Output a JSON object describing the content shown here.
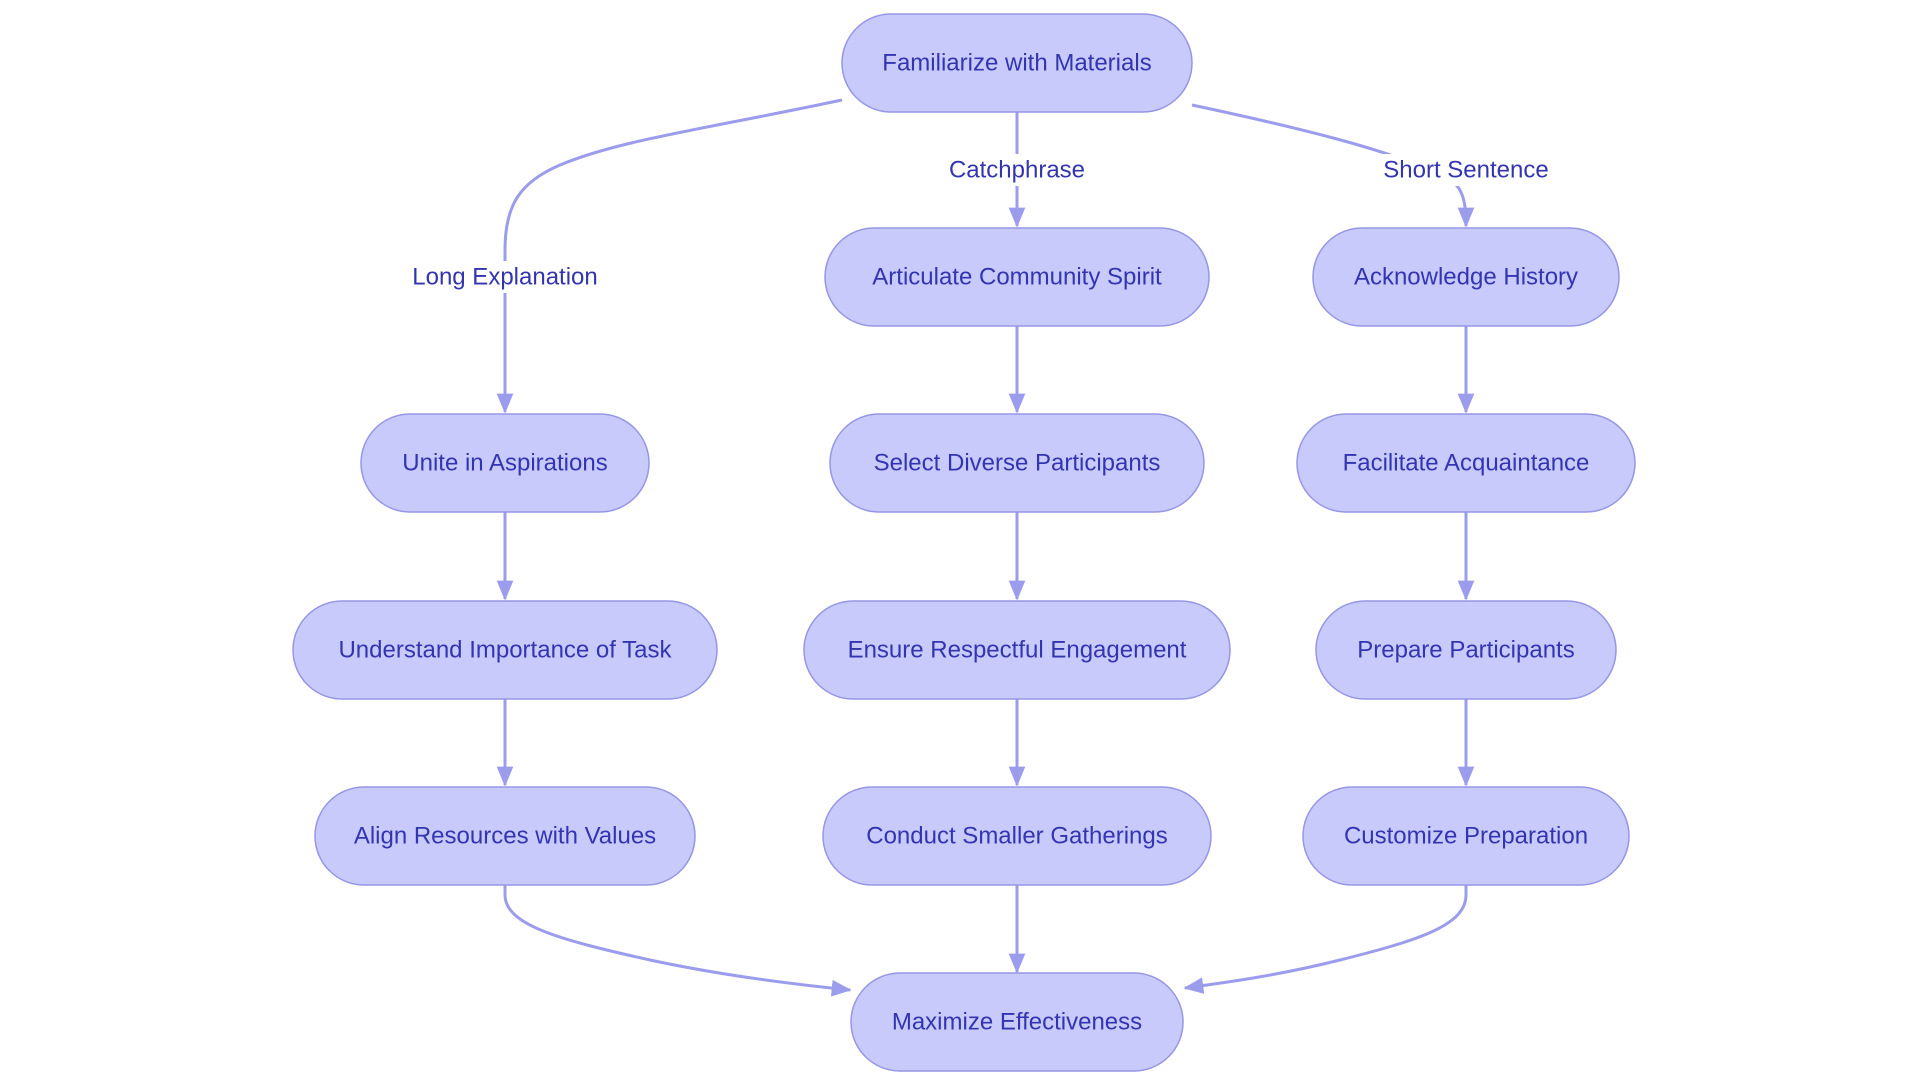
{
  "diagram": {
    "type": "flowchart",
    "colors": {
      "node_fill": "#c9cafc",
      "node_stroke": "#9597e4",
      "text": "#3334b0",
      "edge": "#9b9dec"
    },
    "nodes": [
      {
        "id": "familiarize",
        "label": "Familiarize with Materials"
      },
      {
        "id": "unite",
        "label": "Unite in Aspirations"
      },
      {
        "id": "understand",
        "label": "Understand Importance of Task"
      },
      {
        "id": "align",
        "label": "Align Resources with Values"
      },
      {
        "id": "articulate",
        "label": "Articulate Community Spirit"
      },
      {
        "id": "select",
        "label": "Select Diverse Participants"
      },
      {
        "id": "ensure",
        "label": "Ensure Respectful Engagement"
      },
      {
        "id": "conduct",
        "label": "Conduct Smaller Gatherings"
      },
      {
        "id": "acknowledge",
        "label": "Acknowledge History"
      },
      {
        "id": "facilitate",
        "label": "Facilitate Acquaintance"
      },
      {
        "id": "prepare",
        "label": "Prepare Participants"
      },
      {
        "id": "customize",
        "label": "Customize Preparation"
      },
      {
        "id": "maximize",
        "label": "Maximize Effectiveness"
      }
    ],
    "edges": [
      {
        "from": "familiarize",
        "to": "unite",
        "label": "Long Explanation"
      },
      {
        "from": "familiarize",
        "to": "articulate",
        "label": "Catchphrase"
      },
      {
        "from": "familiarize",
        "to": "acknowledge",
        "label": "Short Sentence"
      },
      {
        "from": "unite",
        "to": "understand",
        "label": ""
      },
      {
        "from": "understand",
        "to": "align",
        "label": ""
      },
      {
        "from": "align",
        "to": "maximize",
        "label": ""
      },
      {
        "from": "articulate",
        "to": "select",
        "label": ""
      },
      {
        "from": "select",
        "to": "ensure",
        "label": ""
      },
      {
        "from": "ensure",
        "to": "conduct",
        "label": ""
      },
      {
        "from": "conduct",
        "to": "maximize",
        "label": ""
      },
      {
        "from": "acknowledge",
        "to": "facilitate",
        "label": ""
      },
      {
        "from": "facilitate",
        "to": "prepare",
        "label": ""
      },
      {
        "from": "prepare",
        "to": "customize",
        "label": ""
      },
      {
        "from": "customize",
        "to": "maximize",
        "label": ""
      }
    ]
  }
}
